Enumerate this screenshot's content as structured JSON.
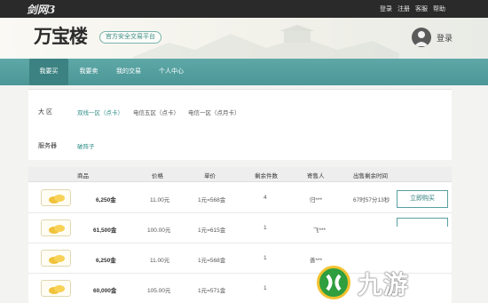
{
  "topbar": {
    "game_logo": "剑网3",
    "links": [
      "登录",
      "注册",
      "客服",
      "帮助"
    ]
  },
  "header": {
    "brand": "万宝楼",
    "slogan": "官方安全交易平台",
    "login": "登录"
  },
  "nav": {
    "items": [
      {
        "label": "我要买",
        "active": true
      },
      {
        "label": "我要卖",
        "active": false
      },
      {
        "label": "我的交易",
        "active": false
      },
      {
        "label": "个人中心",
        "active": false
      }
    ]
  },
  "filters": {
    "region_label": "大  区",
    "region_options": [
      "双线一区（点卡）",
      "电信五区（点卡）",
      "电信一区（点月卡）"
    ],
    "server_label": "服务器",
    "server_options": [
      "破阵子"
    ]
  },
  "table": {
    "headers": [
      "商品",
      "价格",
      "单价",
      "剩余件数",
      "寄售人",
      "出售剩余时间"
    ],
    "rows": [
      {
        "amount": "6,250金",
        "price": "11.00元",
        "unit": "1元=568金",
        "count": "4",
        "seller": "归***",
        "time": "67时57分13秒",
        "button": "立即购买"
      },
      {
        "amount": "61,500金",
        "price": "100.00元",
        "unit": "1元=615金",
        "count": "1",
        "seller": "飞***",
        "time": "",
        "button": ""
      },
      {
        "amount": "6,250金",
        "price": "11.00元",
        "unit": "1元=568金",
        "count": "1",
        "seller": "善***",
        "time": "",
        "button": ""
      },
      {
        "amount": "60,000金",
        "price": "105.00元",
        "unit": "1元=571金",
        "count": "1",
        "seller": "",
        "time": "",
        "button": ""
      }
    ]
  },
  "watermark": {
    "text": "九游"
  },
  "colors": {
    "teal": "#4b9696",
    "teal_dark": "#3c8282",
    "link": "#2f8d86",
    "topbar": "#2a2a2a"
  }
}
